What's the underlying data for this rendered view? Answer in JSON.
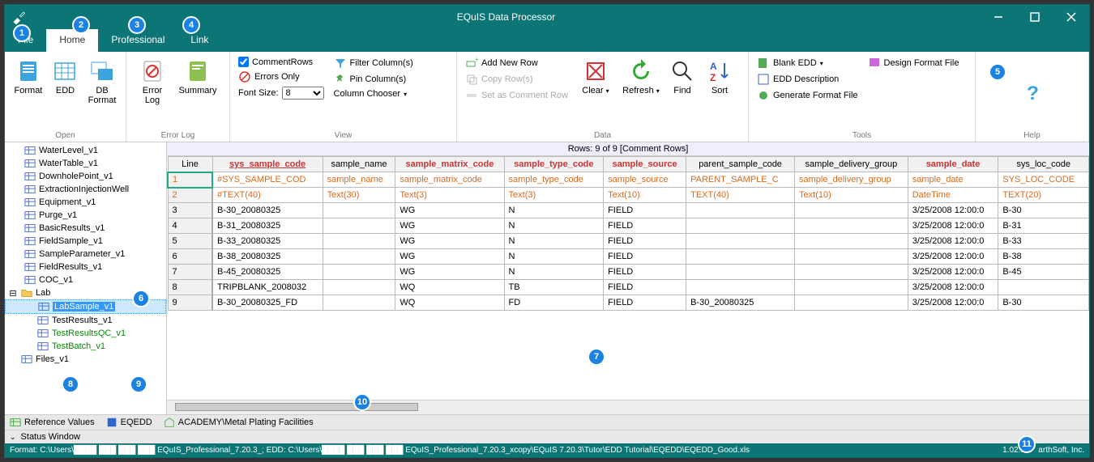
{
  "title": "EQuIS Data Processor",
  "tabs": [
    "File",
    "Home",
    "Professional",
    "Link"
  ],
  "active_tab": 1,
  "ribbon": {
    "open": {
      "label": "Open",
      "format": "Format",
      "edd": "EDD",
      "db_format": "DB\nFormat"
    },
    "error_log": {
      "label": "Error Log",
      "error_log": "Error\nLog",
      "summary": "Summary"
    },
    "view": {
      "label": "View",
      "comment_rows": "CommentRows",
      "errors_only": "Errors Only",
      "font_size": "Font Size:",
      "font_size_val": "8",
      "filter_columns": "Filter Column(s)",
      "pin_columns": "Pin Column(s)",
      "column_chooser": "Column Chooser"
    },
    "data": {
      "label": "Data",
      "add_new_row": "Add New Row",
      "copy_rows": "Copy Row(s)",
      "set_comment_row": "Set as Comment Row",
      "clear": "Clear",
      "refresh": "Refresh",
      "find": "Find",
      "sort": "Sort"
    },
    "tools": {
      "label": "Tools",
      "blank_edd": "Blank EDD",
      "edd_desc": "EDD Description",
      "gen_format": "Generate Format File",
      "design_format": "Design Format File"
    },
    "help": {
      "label": "Help"
    }
  },
  "tree": {
    "items": [
      "WaterLevel_v1",
      "WaterTable_v1",
      "DownholePoint_v1",
      "ExtractionInjectionWell",
      "Equipment_v1",
      "Purge_v1",
      "BasicResults_v1",
      "FieldSample_v1",
      "SampleParameter_v1",
      "FieldResults_v1",
      "COC_v1"
    ],
    "folder": "Lab",
    "lab_items": [
      "LabSample_v1",
      "TestResults_v1",
      "TestResultsQC_v1",
      "TestBatch_v1"
    ],
    "files": "Files_v1"
  },
  "grid": {
    "rows_label": "Rows: 9 of 9   [Comment Rows]",
    "columns": [
      {
        "text": "Line",
        "cls": ""
      },
      {
        "text": "sys_sample_code",
        "cls": "red"
      },
      {
        "text": "sample_name",
        "cls": ""
      },
      {
        "text": "sample_matrix_code",
        "cls": "redplain"
      },
      {
        "text": "sample_type_code",
        "cls": "redplain"
      },
      {
        "text": "sample_source",
        "cls": "redplain"
      },
      {
        "text": "parent_sample_code",
        "cls": ""
      },
      {
        "text": "sample_delivery_group",
        "cls": ""
      },
      {
        "text": "sample_date",
        "cls": "redplain"
      },
      {
        "text": "sys_loc_code",
        "cls": ""
      }
    ],
    "rows": [
      {
        "n": "1",
        "c": [
          "#SYS_SAMPLE_COD",
          "sample_name",
          "sample_matrix_code",
          "sample_type_code",
          "sample_source",
          "PARENT_SAMPLE_C",
          "sample_delivery_group",
          "sample_date",
          "SYS_LOC_CODE"
        ],
        "hdr": true
      },
      {
        "n": "2",
        "c": [
          "#TEXT(40)",
          "Text(30)",
          "Text(3)",
          "Text(3)",
          "Text(10)",
          "TEXT(40)",
          "Text(10)",
          "DateTime",
          "TEXT(20)"
        ],
        "hdr": true
      },
      {
        "n": "3",
        "c": [
          "B-30_20080325",
          "",
          "WG",
          "N",
          "FIELD",
          "",
          "",
          "3/25/2008 12:00:0",
          "B-30"
        ]
      },
      {
        "n": "4",
        "c": [
          "B-31_20080325",
          "",
          "WG",
          "N",
          "FIELD",
          "",
          "",
          "3/25/2008 12:00:0",
          "B-31"
        ]
      },
      {
        "n": "5",
        "c": [
          "B-33_20080325",
          "",
          "WG",
          "N",
          "FIELD",
          "",
          "",
          "3/25/2008 12:00:0",
          "B-33"
        ]
      },
      {
        "n": "6",
        "c": [
          "B-38_20080325",
          "",
          "WG",
          "N",
          "FIELD",
          "",
          "",
          "3/25/2008 12:00:0",
          "B-38"
        ]
      },
      {
        "n": "7",
        "c": [
          "B-45_20080325",
          "",
          "WG",
          "N",
          "FIELD",
          "",
          "",
          "3/25/2008 12:00:0",
          "B-45"
        ]
      },
      {
        "n": "8",
        "c": [
          "TRIPBLANK_2008032",
          "",
          "WQ",
          "TB",
          "FIELD",
          "",
          "",
          "3/25/2008 12:00:0",
          ""
        ]
      },
      {
        "n": "9",
        "c": [
          "B-30_20080325_FD",
          "",
          "WQ",
          "FD",
          "FIELD",
          "B-30_20080325",
          "",
          "3/25/2008 12:00:0",
          "B-30"
        ]
      }
    ]
  },
  "bottom_tabs": {
    "ref_values": "Reference Values",
    "eqedd": "EQEDD",
    "academy": "ACADEMY\\Metal Plating Facilities"
  },
  "status_window": "Status Window",
  "statusbar": {
    "format": "Format:  C:\\Users\\",
    "format2": "EQuIS_Professional_7.20.3_;  EDD:  C:\\Users\\",
    "edd2": "EQuIS_Professional_7.20.3_xcopy\\EQuIS 7.20.3\\Tutor\\EDD Tutorial\\EQEDD\\EQEDD_Good.xls",
    "version": "1.02.117",
    "company": "arthSoft, Inc."
  },
  "callouts": [
    "1",
    "2",
    "3",
    "4",
    "5",
    "6",
    "7",
    "8",
    "9",
    "10",
    "11"
  ]
}
